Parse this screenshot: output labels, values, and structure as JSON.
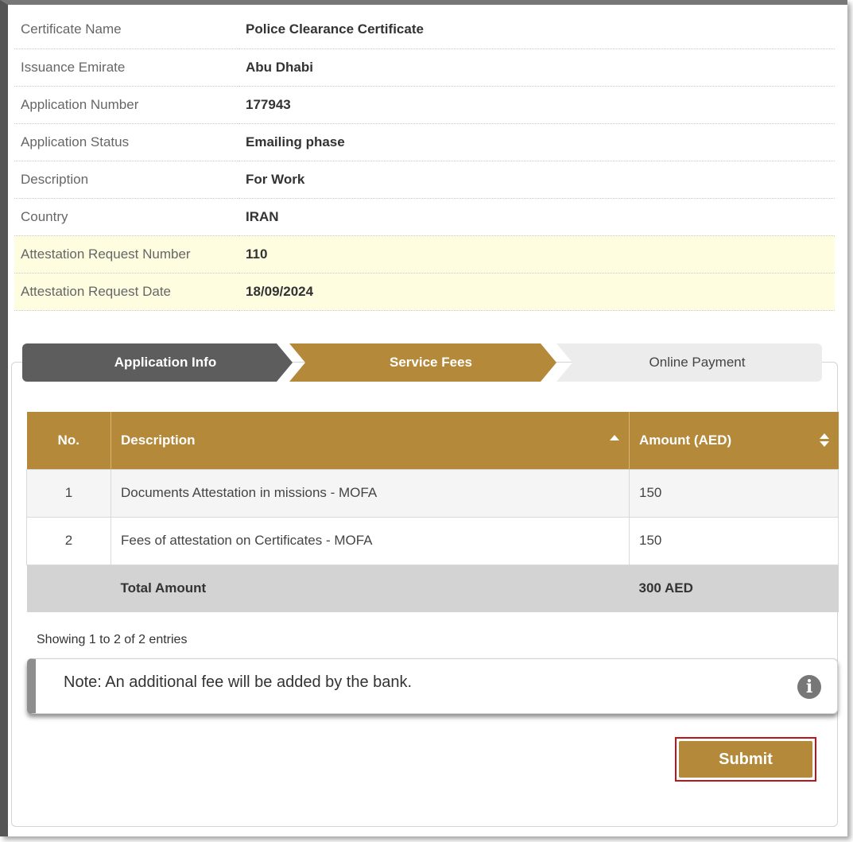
{
  "info_rows": [
    {
      "label": "Certificate Name",
      "value": "Police Clearance Certificate"
    },
    {
      "label": "Issuance Emirate",
      "value": "Abu Dhabi"
    },
    {
      "label": "Application Number",
      "value": "177943"
    },
    {
      "label": "Application Status",
      "value": "Emailing phase"
    },
    {
      "label": "Description",
      "value": "For Work"
    },
    {
      "label": "Country",
      "value": "IRAN"
    },
    {
      "label": "Attestation Request Number",
      "value": "110"
    },
    {
      "label": "Attestation Request Date",
      "value": "18/09/2024"
    }
  ],
  "steps": [
    {
      "label": "Application Info",
      "state": "completed"
    },
    {
      "label": "Service Fees",
      "state": "active"
    },
    {
      "label": "Online Payment",
      "state": "pending"
    }
  ],
  "fees_table": {
    "headers": {
      "no": "No.",
      "description": "Description",
      "amount": "Amount (AED)"
    },
    "rows": [
      {
        "no": "1",
        "description": "Documents Attestation in missions - MOFA",
        "amount": "150"
      },
      {
        "no": "2",
        "description": "Fees of attestation on Certificates - MOFA",
        "amount": "150"
      }
    ],
    "total": {
      "label": "Total Amount",
      "amount": "300 AED"
    }
  },
  "showing_text": "Showing 1 to 2 of 2 entries",
  "note": {
    "text": "Note: An additional fee will be added by the bank.",
    "icon": "info-icon"
  },
  "submit_label": "Submit",
  "colors": {
    "accent": "#b4893a",
    "dark_step": "#5d5d5d",
    "highlight_row": "#fffde0",
    "submit_outline": "#c0141c"
  }
}
